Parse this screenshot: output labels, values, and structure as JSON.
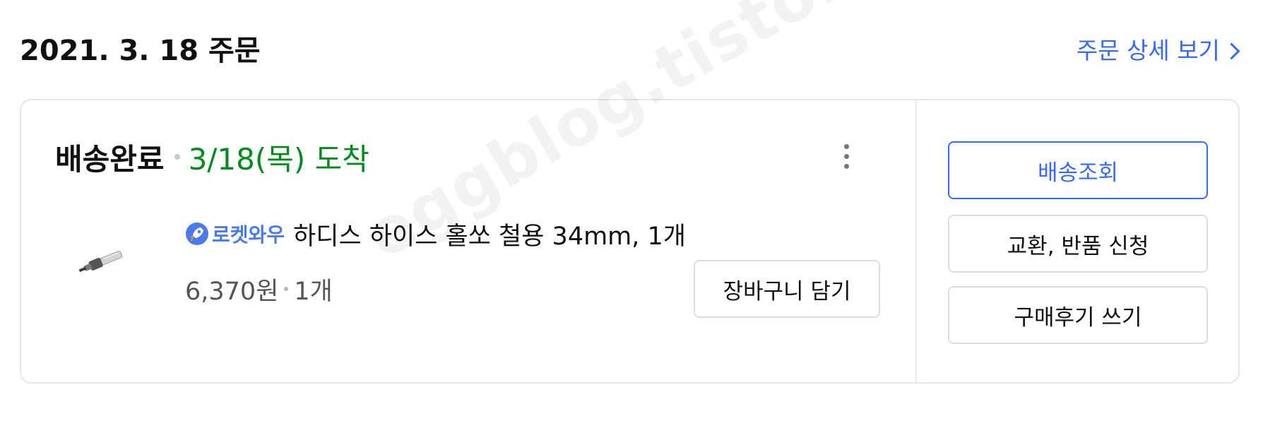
{
  "order": {
    "date_heading": "2021. 3. 18 주문",
    "detail_link_label": "주문 상세 보기"
  },
  "shipment": {
    "status": "배송완료",
    "arrival": "3/18(목) 도착"
  },
  "product": {
    "badge_text": "로켓와우",
    "name": "하디스 하이스 홀쏘 철용 34mm, 1개",
    "price": "6,370원",
    "quantity": "1개"
  },
  "actions": {
    "add_to_cart": "장바구니 담기",
    "track_delivery": "배송조회",
    "exchange_return": "교환, 반품 신청",
    "write_review": "구매후기 쓰기"
  },
  "watermark": "eggblog.tistory.com",
  "colors": {
    "accent_blue": "#346aff",
    "arrival_green": "#008c1c",
    "badge_blue": "#4a7be8"
  },
  "icons": {
    "detail_link": "chevron-right-icon",
    "more": "more-vertical-icon",
    "badge": "rocket-icon"
  }
}
